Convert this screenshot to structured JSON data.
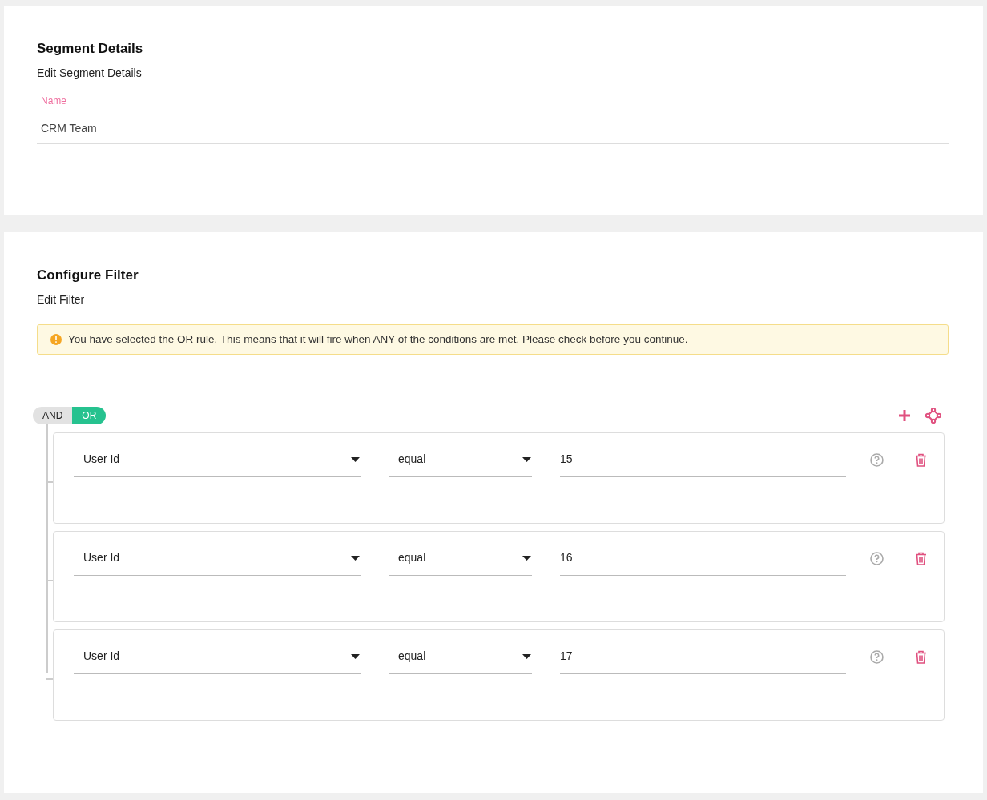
{
  "segment_details": {
    "title": "Segment Details",
    "subtitle": "Edit Segment Details",
    "name_field": {
      "label": "Name",
      "value": "CRM Team"
    }
  },
  "configure_filter": {
    "title": "Configure Filter",
    "subtitle": "Edit Filter",
    "alert": "You have selected the OR rule. This means that it will fire when ANY of the conditions are met. Please check before you continue.",
    "combinator": [
      {
        "label": "AND",
        "selected": false
      },
      {
        "label": "OR",
        "selected": true
      }
    ],
    "rules": [
      {
        "field": "User Id",
        "operator": "equal",
        "value": "15"
      },
      {
        "field": "User Id",
        "operator": "equal",
        "value": "16"
      },
      {
        "field": "User Id",
        "operator": "equal",
        "value": "17"
      }
    ]
  }
}
